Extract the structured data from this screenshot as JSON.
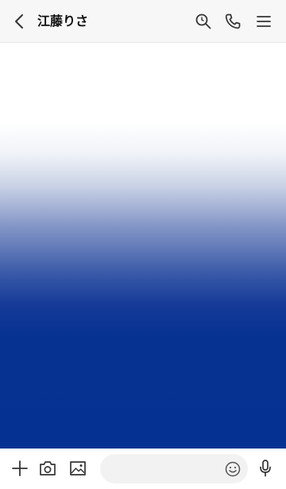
{
  "header": {
    "title": "江藤りさ",
    "icons": [
      "back-icon",
      "search-icon",
      "phone-icon",
      "menu-icon"
    ]
  },
  "chat": {
    "background_colors": [
      "#ffffff",
      "#053292"
    ]
  },
  "footer": {
    "icons": [
      "plus-icon",
      "camera-icon",
      "image-icon",
      "emoji-icon",
      "microphone-icon"
    ],
    "message_input": {
      "value": "",
      "placeholder": ""
    }
  },
  "colors": {
    "header_bg": "#f7f7f7",
    "icon": "#333333",
    "gradient_bottom": "#053292",
    "input_bg": "#f2f2f2"
  }
}
